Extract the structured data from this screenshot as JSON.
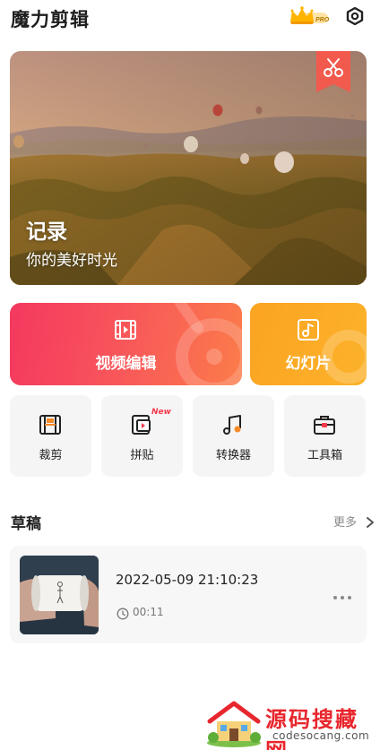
{
  "app": {
    "title": "魔力剪辑",
    "vip_badge_text": "PRO"
  },
  "banner": {
    "title": "记录",
    "subtitle": "你的美好时光"
  },
  "main_actions": [
    {
      "label": "视频编辑",
      "icon": "film-icon"
    },
    {
      "label": "幻灯片",
      "icon": "music-note-icon"
    }
  ],
  "tools": [
    {
      "label": "裁剪",
      "icon": "crop-film-icon"
    },
    {
      "label": "拼贴",
      "icon": "collage-icon",
      "badge": "New"
    },
    {
      "label": "转换器",
      "icon": "music-convert-icon"
    },
    {
      "label": "工具箱",
      "icon": "toolbox-icon"
    }
  ],
  "drafts": {
    "title": "草稿",
    "more_label": "更多",
    "items": [
      {
        "date": "2022-05-09 21:10:23",
        "duration": "00:11"
      }
    ]
  },
  "watermark": {
    "text": "源码搜藏网",
    "url": "codesocang.com"
  },
  "colors": {
    "video_card_start": "#f4385f",
    "video_card_end": "#fb7c4a",
    "slideshow_card": "#fba421",
    "new_badge": "#f53a4a",
    "watermark_red": "#e8262d"
  }
}
